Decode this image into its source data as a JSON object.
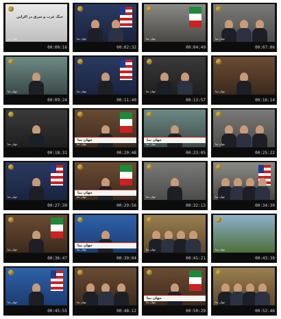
{
  "thumbnails": [
    {
      "timestamp": "00:00:16",
      "channel_tag": "جهان نما",
      "headline": "جنگ غرب و شرق در اکراین",
      "theme": "news-paper",
      "people": 0,
      "flags": []
    },
    {
      "timestamp": "00:02:32",
      "channel_tag": "جهان نما",
      "theme": "navy",
      "people": 2,
      "flags": [
        "us"
      ]
    },
    {
      "timestamp": "00:04:49",
      "channel_tag": "جهان نما",
      "theme": "crowd",
      "people": 0,
      "flags": [
        "iran"
      ]
    },
    {
      "timestamp": "00:07:06",
      "channel_tag": "جهان نما",
      "theme": "room",
      "people": 3,
      "flags": []
    },
    {
      "timestamp": "00:09:24",
      "channel_tag": "جهان نما",
      "theme": "teal",
      "people": 1,
      "flags": []
    },
    {
      "timestamp": "00:11:40",
      "channel_tag": "جهان نما",
      "theme": "navy",
      "people": 1,
      "flags": [
        "us"
      ]
    },
    {
      "timestamp": "00:13:57",
      "channel_tag": "جهان نما",
      "theme": "dark",
      "people": 2,
      "flags": []
    },
    {
      "timestamp": "00:16:14",
      "channel_tag": "جهان نما",
      "theme": "warm",
      "people": 1,
      "flags": []
    },
    {
      "timestamp": "00:18:31",
      "channel_tag": "جهان نما",
      "theme": "dark",
      "people": 1,
      "flags": []
    },
    {
      "timestamp": "00:20:48",
      "channel_tag": "جهان نما",
      "theme": "warm",
      "people": 1,
      "flags": [
        "iran"
      ],
      "lower_third": "جهان نما"
    },
    {
      "timestamp": "00:23:05",
      "channel_tag": "جهان نما",
      "theme": "teal",
      "people": 1,
      "flags": [],
      "lower_third": "جهان نما"
    },
    {
      "timestamp": "00:25:22",
      "channel_tag": "جهان نما",
      "theme": "room",
      "people": 3,
      "flags": []
    },
    {
      "timestamp": "00:27:39",
      "channel_tag": "جهان نما",
      "theme": "navy",
      "people": 1,
      "flags": [
        "us"
      ]
    },
    {
      "timestamp": "00:29:56",
      "channel_tag": "جهان نما",
      "theme": "warm",
      "people": 1,
      "flags": [
        "iran"
      ],
      "lower_third": "جهان نما"
    },
    {
      "timestamp": "00:32:13",
      "channel_tag": "جهان نما",
      "theme": "room",
      "people": 1,
      "flags": []
    },
    {
      "timestamp": "00:34:30",
      "channel_tag": "جهان نما",
      "theme": "crowd",
      "people": 4,
      "flags": [
        "us"
      ]
    },
    {
      "timestamp": "00:36:47",
      "channel_tag": "جهان نما",
      "theme": "warm",
      "people": 1,
      "flags": [
        "iran"
      ]
    },
    {
      "timestamp": "00:39:04",
      "channel_tag": "جهان نما",
      "theme": "blue",
      "people": 1,
      "flags": [],
      "lower_third": "جهان نما"
    },
    {
      "timestamp": "00:41:21",
      "channel_tag": "جهان نما",
      "theme": "tan",
      "people": 4,
      "flags": []
    },
    {
      "timestamp": "00:43:38",
      "channel_tag": "جهان نما",
      "theme": "green",
      "people": 0,
      "flags": []
    },
    {
      "timestamp": "00:45:55",
      "channel_tag": "جهان نما",
      "theme": "blue",
      "people": 1,
      "flags": [
        "us"
      ]
    },
    {
      "timestamp": "00:48:12",
      "channel_tag": "جهان نما",
      "theme": "warm",
      "people": 3,
      "flags": []
    },
    {
      "timestamp": "00:50:29",
      "channel_tag": "جهان نما",
      "theme": "warm",
      "people": 1,
      "flags": [
        "iran"
      ],
      "lower_third": "جهان نما"
    },
    {
      "timestamp": "00:52:46",
      "channel_tag": "جهان نما",
      "theme": "tan",
      "people": 4,
      "flags": []
    }
  ],
  "colors": {
    "logo": "#c8a43a",
    "strip": "#0c0c0c",
    "timestamp_text": "#d6d6d6"
  }
}
